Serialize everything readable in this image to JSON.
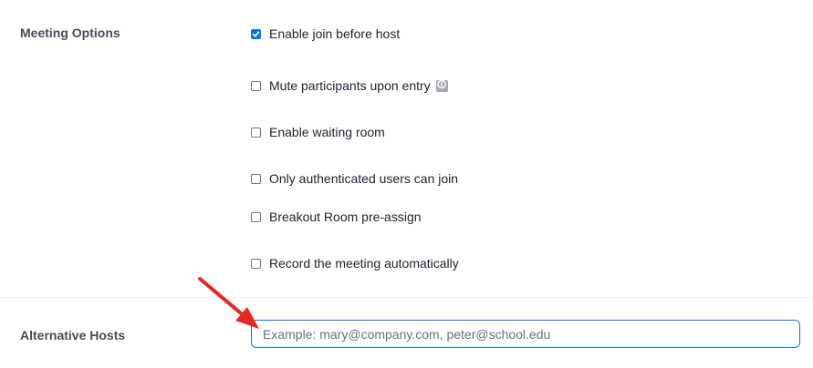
{
  "meeting_options": {
    "label": "Meeting Options",
    "options": [
      {
        "label": "Enable join before host",
        "checked": true
      },
      {
        "label": "Mute participants upon entry",
        "checked": false,
        "info_icon": "info-icon"
      },
      {
        "label": "Enable waiting room",
        "checked": false
      },
      {
        "label": "Only authenticated users can join",
        "checked": false
      },
      {
        "label": "Breakout Room pre-assign",
        "checked": false
      },
      {
        "label": "Record the meeting automatically",
        "checked": false
      }
    ]
  },
  "alternative_hosts": {
    "label": "Alternative Hosts",
    "placeholder": "Example: mary@company.com, peter@school.edu",
    "value": ""
  },
  "colors": {
    "accent": "#0e72ed",
    "annotation_arrow": "#e8261f"
  }
}
